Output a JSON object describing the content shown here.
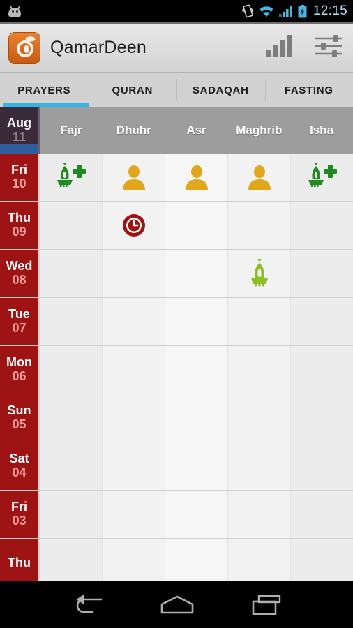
{
  "statusbar": {
    "time": "12:15",
    "icons": [
      "android-head-icon",
      "vibrate-icon",
      "wifi-icon",
      "signal-icon",
      "battery-charging-icon"
    ]
  },
  "actionbar": {
    "app_icon": "qamardeen-app-icon",
    "title": "QamarDeen",
    "actions": [
      {
        "name": "statistics-icon",
        "label": "Statistics"
      },
      {
        "name": "settings-sliders-icon",
        "label": "Settings"
      }
    ]
  },
  "tabs": {
    "items": [
      {
        "label": "PRAYERS",
        "active": true
      },
      {
        "label": "QURAN",
        "active": false
      },
      {
        "label": "SADAQAH",
        "active": false
      },
      {
        "label": "FASTING",
        "active": false
      }
    ],
    "indicator_color": "#33b5e5"
  },
  "grid": {
    "header": {
      "month": "Aug",
      "day": "11",
      "columns": [
        "Fajr",
        "Dhuhr",
        "Asr",
        "Maghrib",
        "Isha"
      ]
    },
    "rows": [
      {
        "dow": "Fri",
        "num": "10",
        "cells": [
          "mosque-plus",
          "person",
          "person",
          "person",
          "mosque-plus"
        ]
      },
      {
        "dow": "Thu",
        "num": "09",
        "cells": [
          "none",
          "clock",
          "none",
          "none",
          "none"
        ]
      },
      {
        "dow": "Wed",
        "num": "08",
        "cells": [
          "none",
          "none",
          "none",
          "mosque",
          "none"
        ]
      },
      {
        "dow": "Tue",
        "num": "07",
        "cells": [
          "none",
          "none",
          "none",
          "none",
          "none"
        ]
      },
      {
        "dow": "Mon",
        "num": "06",
        "cells": [
          "none",
          "none",
          "none",
          "none",
          "none"
        ]
      },
      {
        "dow": "Sun",
        "num": "05",
        "cells": [
          "none",
          "none",
          "none",
          "none",
          "none"
        ]
      },
      {
        "dow": "Sat",
        "num": "04",
        "cells": [
          "none",
          "none",
          "none",
          "none",
          "none"
        ]
      },
      {
        "dow": "Fri",
        "num": "03",
        "cells": [
          "none",
          "none",
          "none",
          "none",
          "none"
        ]
      },
      {
        "dow": "Thu",
        "num": "",
        "cells": [
          "none",
          "none",
          "none",
          "none",
          "none"
        ]
      }
    ],
    "legend_colors": {
      "congregation": "#1f8a1f",
      "mosque": "#8cbf26",
      "alone": "#e0a61c",
      "late": "#9e1313",
      "empty_dot": "#c3c3c3",
      "date_column": "#9e1313"
    }
  },
  "navbar": {
    "buttons": [
      {
        "name": "back-button",
        "label": "Back"
      },
      {
        "name": "home-button",
        "label": "Home"
      },
      {
        "name": "recents-button",
        "label": "Recents"
      }
    ]
  }
}
